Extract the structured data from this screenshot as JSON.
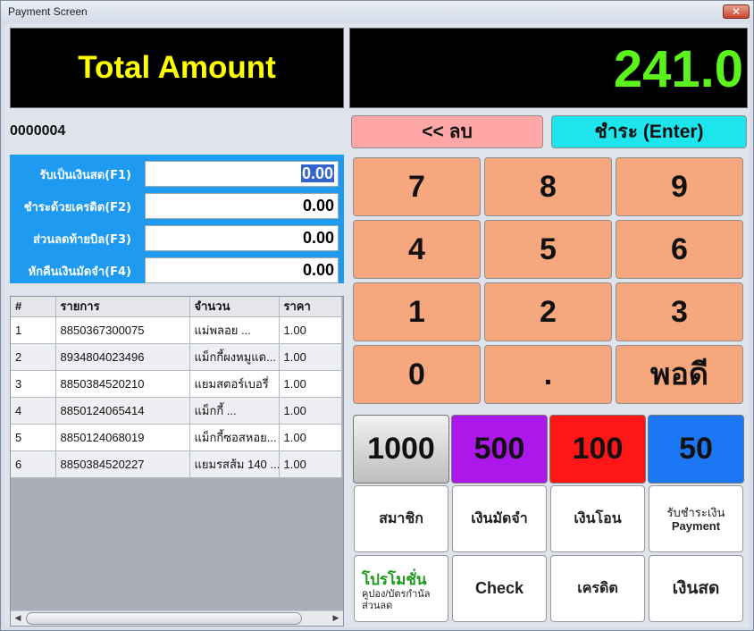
{
  "window": {
    "title": "Payment Screen",
    "close_label": "✕"
  },
  "total": {
    "label": "Total Amount",
    "value": "241.0"
  },
  "bill_number": "0000004",
  "payments": [
    {
      "label": "รับเป็นเงินสด(F1)",
      "value": "0.00",
      "selected": true
    },
    {
      "label": "ชำระด้วยเครดิต(F2)",
      "value": "0.00"
    },
    {
      "label": "ส่วนลดท้ายบิล(F3)",
      "value": "0.00"
    },
    {
      "label": "หักคืนเงินมัดจำ(F4)",
      "value": "0.00"
    }
  ],
  "table": {
    "headers": [
      "#",
      "รายการ",
      "จำนวน",
      "ราคา"
    ],
    "rows": [
      [
        "1",
        "8850367300075",
        "แม่พลอย ...",
        "1.00"
      ],
      [
        "2",
        "8934804023496",
        "แม็กกี้ผงหมูแด...",
        "1.00"
      ],
      [
        "3",
        "8850384520210",
        "แยมสตอร์เบอรี่",
        "1.00"
      ],
      [
        "4",
        "8850124065414",
        "แม็กกี้ ...",
        "1.00"
      ],
      [
        "5",
        "8850124068019",
        "แม็กกี้ซอสหอย...",
        "1.00"
      ],
      [
        "6",
        "8850384520227",
        "แยมรสส้ม 140 ...",
        "1.00"
      ]
    ]
  },
  "actions": {
    "delete_label": "<< ลบ",
    "pay_label": "ชำระ (Enter)"
  },
  "keypad": [
    "7",
    "8",
    "9",
    "4",
    "5",
    "6",
    "1",
    "2",
    "3",
    "0",
    ".",
    "พอดี"
  ],
  "bills": [
    {
      "label": "1000",
      "color": "#bdbdbd"
    },
    {
      "label": "500",
      "color": "#ad18ea"
    },
    {
      "label": "100",
      "color": "#ff1616"
    },
    {
      "label": "50",
      "color": "#1c77f5"
    }
  ],
  "functions": {
    "member": "สมาชิก",
    "deposit": "เงินมัดจำ",
    "transfer": "เงินโอน",
    "payment_line1": "รับชำระเงิน",
    "payment_line2": "Payment",
    "promo_title": "โปรโมชั่น",
    "promo_sub1": "คูปอง/บัตรกำนัล",
    "promo_sub2": "ส่วนลด",
    "check": "Check",
    "credit": "เครดิต",
    "cash": "เงินสด"
  },
  "colors": {
    "total_label": "#ffff00",
    "total_value": "#5cf21c",
    "payment_panel": "#1e9af0",
    "keypad": "#f6a77d",
    "delete_button": "#ffa7a7",
    "pay_button": "#1ee5ec",
    "promo_title": "#1c9a1c"
  }
}
